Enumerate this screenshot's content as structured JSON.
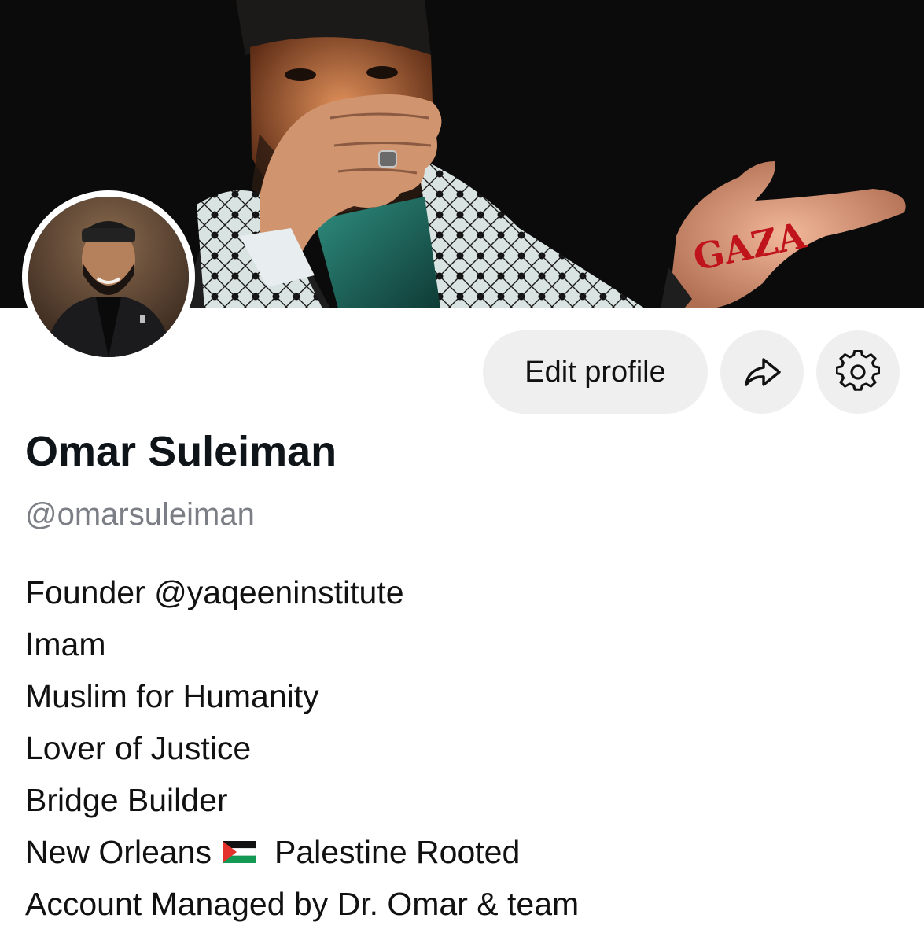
{
  "profile": {
    "name": "Omar Suleiman",
    "handle": "@omarsuleiman",
    "banner_hand_text": "GAZA"
  },
  "actions": {
    "edit_profile_label": "Edit profile",
    "share_icon": "share-arrow-icon",
    "settings_icon": "gear-icon"
  },
  "bio": {
    "lines": [
      "Founder @yaqeeninstitute",
      "Imam",
      "Muslim for Humanity",
      "Lover of Justice",
      "Bridge Builder"
    ],
    "location_before_flag": "New Orleans",
    "flag_icon": "palestine-flag-icon",
    "location_after_flag": "Palestine Rooted",
    "managed_line": "Account Managed by Dr. Omar & team"
  },
  "colors": {
    "banner_bg": "#0b0b0b",
    "button_bg": "#efefef",
    "name": "#0f1419",
    "handle": "#7b7f85",
    "gaza_text": "#c0141b"
  }
}
